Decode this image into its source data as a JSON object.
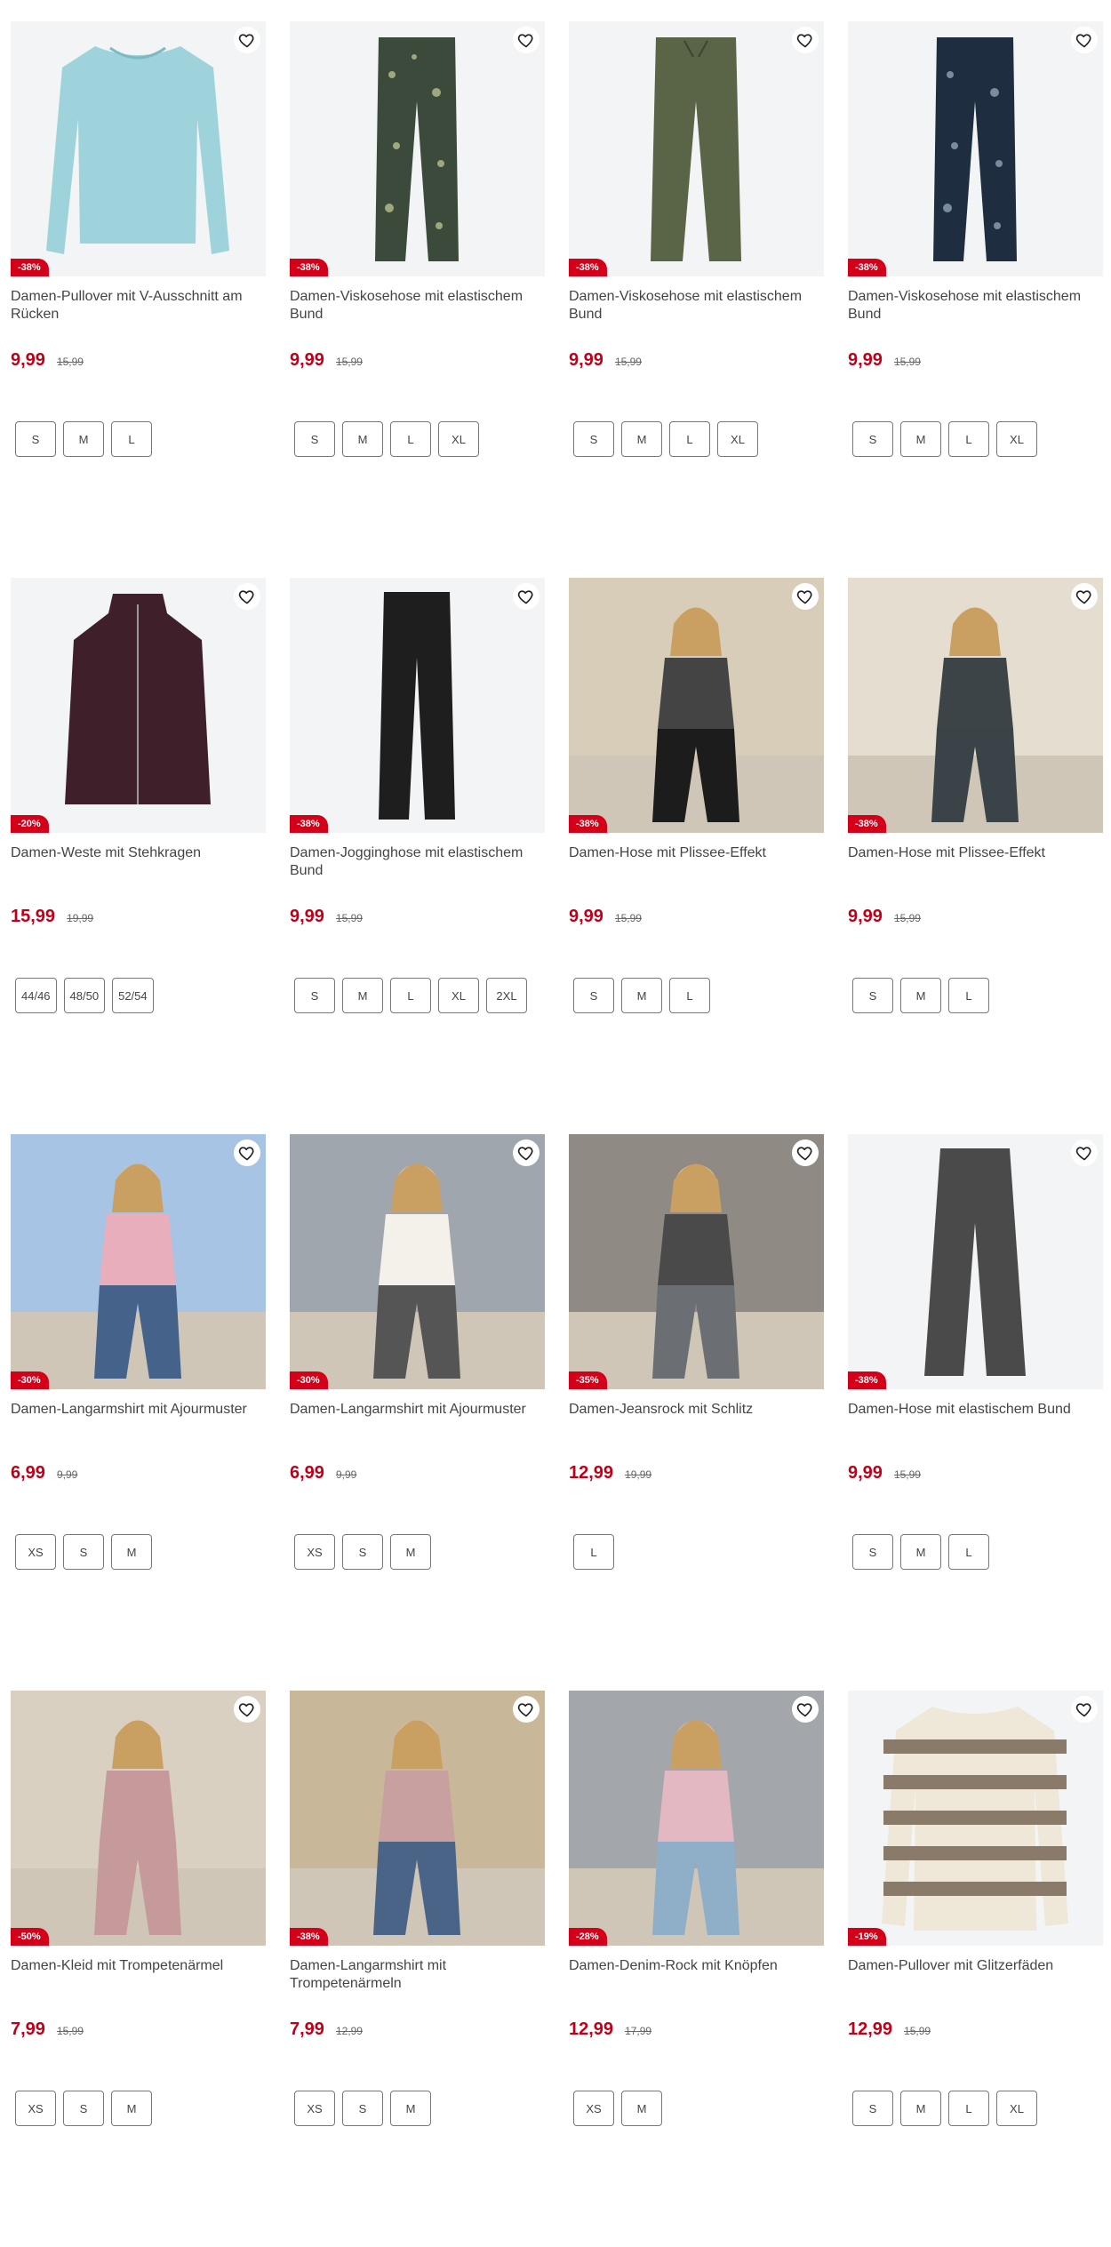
{
  "colors": {
    "sale_red": "#d4001a",
    "price_red": "#c00018"
  },
  "products": [
    {
      "title": "Damen-Pullover mit V-Ausschnitt am Rücken",
      "price": "9,99",
      "old_price": "15,99",
      "badge": "-38%",
      "sizes": [
        "S",
        "M",
        "L"
      ],
      "image": "light-blue-sweater",
      "icon": "heart-icon"
    },
    {
      "title": "Damen-Viskosehose mit elastischem Bund",
      "price": "9,99",
      "old_price": "15,99",
      "badge": "-38%",
      "sizes": [
        "S",
        "M",
        "L",
        "XL"
      ],
      "image": "patterned-pants-green",
      "icon": "heart-icon"
    },
    {
      "title": "Damen-Viskosehose mit elastischem Bund",
      "price": "9,99",
      "old_price": "15,99",
      "badge": "-38%",
      "sizes": [
        "S",
        "M",
        "L",
        "XL"
      ],
      "image": "olive-pants",
      "icon": "heart-icon"
    },
    {
      "title": "Damen-Viskosehose mit elastischem Bund",
      "price": "9,99",
      "old_price": "15,99",
      "badge": "-38%",
      "sizes": [
        "S",
        "M",
        "L",
        "XL"
      ],
      "image": "patterned-pants-navy",
      "icon": "heart-icon"
    },
    {
      "title": "Damen-Weste mit Stehkragen",
      "price": "15,99",
      "old_price": "19,99",
      "badge": "-20%",
      "sizes": [
        "44/46",
        "48/50",
        "52/54"
      ],
      "image": "burgundy-vest",
      "icon": "heart-icon"
    },
    {
      "title": "Damen-Jogginghose mit elastischem Bund",
      "price": "9,99",
      "old_price": "15,99",
      "badge": "-38%",
      "sizes": [
        "S",
        "M",
        "L",
        "XL",
        "2XL"
      ],
      "image": "black-joggers",
      "icon": "heart-icon"
    },
    {
      "title": "Damen-Hose mit Plissee-Effekt",
      "price": "9,99",
      "old_price": "15,99",
      "badge": "-38%",
      "sizes": [
        "S",
        "M",
        "L"
      ],
      "image": "model-pleated-pants-black",
      "icon": "heart-icon"
    },
    {
      "title": "Damen-Hose mit Plissee-Effekt",
      "price": "9,99",
      "old_price": "15,99",
      "badge": "-38%",
      "sizes": [
        "S",
        "M",
        "L"
      ],
      "image": "model-pleated-pants-grey",
      "icon": "heart-icon"
    },
    {
      "title": "Damen-Langarmshirt mit Ajourmuster",
      "price": "6,99",
      "old_price": "9,99",
      "badge": "-30%",
      "sizes": [
        "XS",
        "S",
        "M"
      ],
      "image": "model-pink-top",
      "icon": "heart-icon"
    },
    {
      "title": "Damen-Langarmshirt mit Ajourmuster",
      "price": "6,99",
      "old_price": "9,99",
      "badge": "-30%",
      "sizes": [
        "XS",
        "S",
        "M"
      ],
      "image": "model-white-top",
      "icon": "heart-icon"
    },
    {
      "title": "Damen-Jeansrock mit Schlitz",
      "price": "12,99",
      "old_price": "19,99",
      "badge": "-35%",
      "sizes": [
        "L"
      ],
      "image": "model-denim-skirt",
      "icon": "heart-icon"
    },
    {
      "title": "Damen-Hose mit elastischem Bund",
      "price": "9,99",
      "old_price": "15,99",
      "badge": "-38%",
      "sizes": [
        "S",
        "M",
        "L"
      ],
      "image": "grey-wide-pants",
      "icon": "heart-icon"
    },
    {
      "title": "Damen-Kleid mit Trompetenärmel",
      "price": "7,99",
      "old_price": "15,99",
      "badge": "-50%",
      "sizes": [
        "XS",
        "S",
        "M"
      ],
      "image": "model-floral-dress",
      "icon": "heart-icon"
    },
    {
      "title": "Damen-Langarmshirt mit Trompetenärmeln",
      "price": "7,99",
      "old_price": "12,99",
      "badge": "-38%",
      "sizes": [
        "XS",
        "S",
        "M"
      ],
      "image": "model-floral-shirt",
      "icon": "heart-icon"
    },
    {
      "title": "Damen-Denim-Rock mit Knöpfen",
      "price": "12,99",
      "old_price": "17,99",
      "badge": "-28%",
      "sizes": [
        "XS",
        "M"
      ],
      "image": "model-denim-button-skirt",
      "icon": "heart-icon"
    },
    {
      "title": "Damen-Pullover mit Glitzerfäden",
      "price": "12,99",
      "old_price": "15,99",
      "badge": "-19%",
      "sizes": [
        "S",
        "M",
        "L",
        "XL"
      ],
      "image": "striped-sweater",
      "icon": "heart-icon"
    }
  ]
}
